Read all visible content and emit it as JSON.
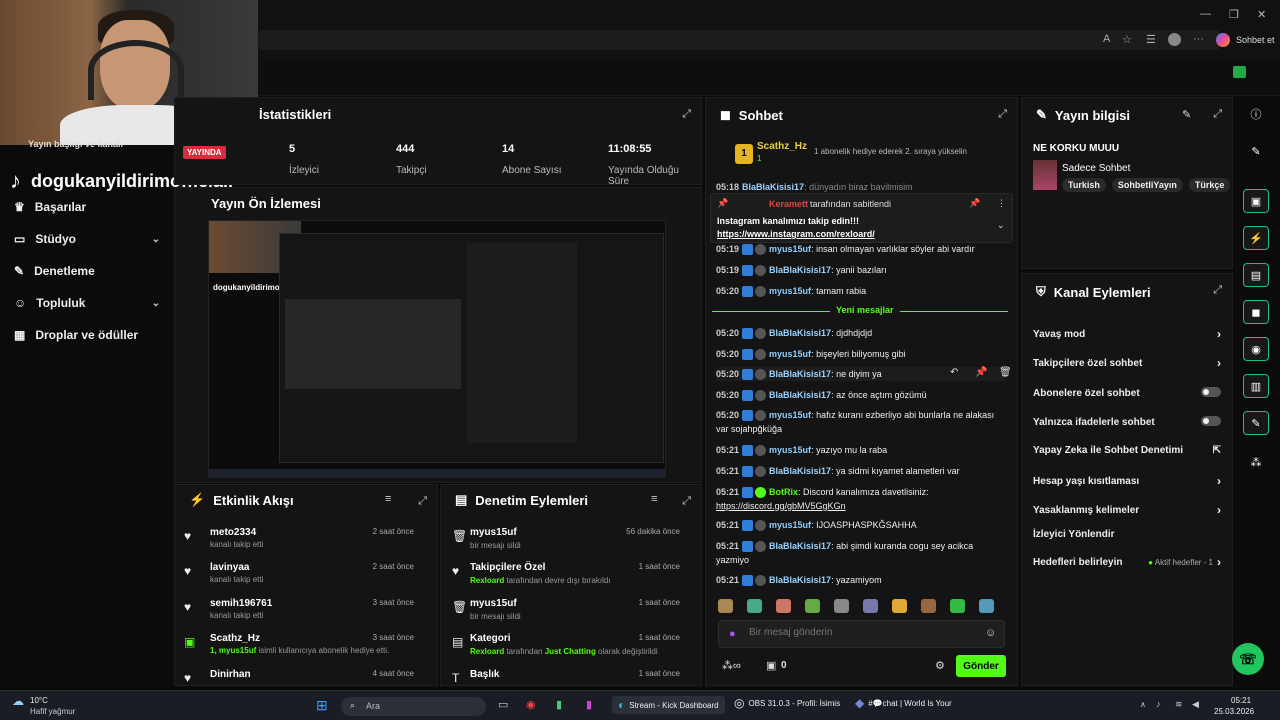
{
  "browser": {
    "right_label": "Sohbet et",
    "minimize": "—",
    "maximize": "❐",
    "close": "✕"
  },
  "overlay": {
    "tiktok_handle": "dogukanyildirimofficiall",
    "live_badge": "YAYINDA",
    "partial_title": "Yayın başlığı ve kanalı"
  },
  "sidebar": {
    "items": [
      {
        "label": "Başarılar",
        "icon": "trophy-icon"
      },
      {
        "label": "Stüdyo",
        "icon": "studio-icon",
        "chev": "⌄"
      },
      {
        "label": "Denetleme",
        "icon": "wrench-icon"
      },
      {
        "label": "Topluluk",
        "icon": "community-icon",
        "chev": "⌄"
      },
      {
        "label": "Droplar ve ödüller",
        "icon": "gift-icon"
      }
    ]
  },
  "stats": {
    "title": "İstatistikleri",
    "items": [
      {
        "value": "5",
        "label": "İzleyici"
      },
      {
        "value": "444",
        "label": "Takipçi"
      },
      {
        "value": "14",
        "label": "Abone Sayısı"
      },
      {
        "value": "11:08:55",
        "label": "Yayında Olduğu Süre"
      }
    ]
  },
  "preview": {
    "title": "Yayın Ön İzlemesi",
    "handle": "dogukanyildirimofficiall"
  },
  "activity": {
    "title": "Etkinlik Akışı",
    "rows": [
      {
        "name": "meto2334",
        "sub": "kanalı takip etti",
        "time": "2 saat önce",
        "icon": "heart-icon",
        "glyph": "♥"
      },
      {
        "name": "lavinyaa",
        "sub": "kanalı takip etti",
        "time": "2 saat önce",
        "icon": "heart-icon",
        "glyph": "♥"
      },
      {
        "name": "semih196761",
        "sub": "kanalı takip etti",
        "time": "3 saat önce",
        "icon": "heart-icon",
        "glyph": "♥"
      },
      {
        "name": "Scathz_Hz",
        "sub_green": "1, myus15uf",
        "sub": " isimli kullanıcıya abonelik hediye etti.",
        "time": "3 saat önce",
        "icon": "gift-icon",
        "glyph": "▣"
      },
      {
        "name": "Dinirhan",
        "sub": "",
        "time": "4 saat önce",
        "icon": "heart-icon",
        "glyph": "♥"
      }
    ]
  },
  "moderation": {
    "title": "Denetim Eylemleri",
    "rows": [
      {
        "name": "myus15uf",
        "sub": "bir mesajı sildi",
        "time": "56 dakika önce",
        "icon": "trash-icon",
        "glyph": "🗑"
      },
      {
        "name": "Takipçilere Özel",
        "sub_green": "Rexloard",
        "sub": " tarafından devre dışı bırakıldı",
        "time": "1 saat önce",
        "icon": "heart-icon",
        "glyph": "♥"
      },
      {
        "name": "myus15uf",
        "sub": "bir mesajı sildi",
        "time": "1 saat önce",
        "icon": "trash-icon",
        "glyph": "🗑"
      },
      {
        "name": "Kategori",
        "sub_green": "Rexloard",
        "sub": " tarafından ",
        "sub_green2": "Just Chatting",
        "sub2": " olarak değiştirildi",
        "time": "1 saat önce",
        "icon": "category-icon",
        "glyph": "▤"
      },
      {
        "name": "Başlık",
        "sub": "",
        "time": "1 saat önce",
        "icon": "title-icon",
        "glyph": "T"
      }
    ]
  },
  "chat": {
    "title": "Sohbet",
    "top_user": "Scathz_Hz",
    "top_user_count": "1",
    "top_notice": "1 abonelik hediye ederek 2. sıraya yükselin",
    "pinned_by": "Keramett",
    "pinned_label": "tarafından sabitlendi",
    "pinned_text": "Instagram kanalımızı takip edin!!!",
    "pinned_link": "https://www.instagram.com/rexloard/",
    "top_partial": {
      "time": "05:18",
      "user": "BlaBlaKisisi17",
      "text": ": dünyadın biraz bavilmisim"
    },
    "new_label": "Yeni mesajlar",
    "messages_before": [
      {
        "time": "05:19",
        "user": "myus15uf",
        "text": ": insan olmayan varlıklar söyler abi vardır",
        "cls": "u1"
      },
      {
        "time": "05:19",
        "user": "BlaBlaKisisi17",
        "text": ": yanii bazıları",
        "cls": "u2"
      },
      {
        "time": "05:20",
        "user": "myus15uf",
        "text": ": tamam rabia",
        "cls": "u1"
      }
    ],
    "messages": [
      {
        "time": "05:20",
        "user": "BlaBlaKisisi17",
        "text": ": djdhdjdjd",
        "cls": "u2"
      },
      {
        "time": "05:20",
        "user": "myus15uf",
        "text": ": bişeyleri biliyomuş gibi",
        "cls": "u1"
      },
      {
        "time": "05:20",
        "user": "BlaBlaKisisi17",
        "text": ": ne diyim ya",
        "cls": "u2"
      },
      {
        "time": "05:20",
        "user": "BlaBlaKisisi17",
        "text": ": az önce açtım gözümü",
        "cls": "u2"
      },
      {
        "time": "05:20",
        "user": "myus15uf",
        "text": ": hafız kuranı ezberliyo abi bunlarla ne alakası var sojahpğküğa",
        "cls": "u1"
      },
      {
        "time": "05:21",
        "user": "myus15uf",
        "text": ": yazıyo mu la raba",
        "cls": "u1"
      },
      {
        "time": "05:21",
        "user": "BlaBlaKisisi17",
        "text": ": ya sidmi kıyamet alametleri var",
        "cls": "u2"
      },
      {
        "time": "05:21",
        "user": "BotRix",
        "text": ": Discord kanalımıza davetlisiniz:",
        "link": "https://discord.gg/gbMV5GgKGn",
        "cls": "ug"
      },
      {
        "time": "05:21",
        "user": "myus15uf",
        "text": ": IJOASPHASPKĞSAHHA",
        "cls": "u1"
      },
      {
        "time": "05:21",
        "user": "BlaBlaKisisi17",
        "text": ": abi şimdi kuranda cogu sey acikca yazmiyo",
        "cls": "u2"
      },
      {
        "time": "05:21",
        "user": "BlaBlaKisisi17",
        "text": ": yazamiyom",
        "cls": "u2"
      }
    ],
    "input_placeholder": "Bir mesaj gönderin",
    "points": "0",
    "send_label": "Gönder"
  },
  "stream_info": {
    "title": "Yayın bilgisi",
    "stream_title": "NE KORKU MUUU",
    "category": "Sadece Sohbet",
    "tags": [
      "Turkish",
      "SohbetliYayın",
      "Türkçe"
    ]
  },
  "channel_actions": {
    "title": "Kanal Eylemleri",
    "items": [
      {
        "label": "Yavaş mod",
        "type": "chev"
      },
      {
        "label": "Takipçilere özel sohbet",
        "type": "chev"
      },
      {
        "label": "Abonelere özel sohbet",
        "type": "toggle"
      },
      {
        "label": "Yalnızca ifadelerle sohbet",
        "type": "toggle"
      },
      {
        "label": "Yapay Zeka ile Sohbet Denetimi",
        "type": "ext"
      },
      {
        "label": "Hesap yaşı kısıtlaması",
        "type": "chev"
      },
      {
        "label": "Yasaklanmış kelimeler",
        "type": "chev"
      },
      {
        "label": "İzleyici Yönlendir",
        "type": "none"
      },
      {
        "label": "Hedefleri belirleyin",
        "type": "goal",
        "extra": "Aktif hedefler - 1"
      }
    ]
  },
  "taskbar": {
    "weather_temp": "10°C",
    "weather_desc": "Hafif yağmur",
    "search_placeholder": "Ara",
    "apps": [
      {
        "label": "Stream - Kick Dashboard"
      },
      {
        "label": "OBS 31.0.3 - Profil: İsimis"
      },
      {
        "label": "#💬chat | World Is Your"
      }
    ],
    "time": "05:21",
    "date": "25.03.2026"
  }
}
